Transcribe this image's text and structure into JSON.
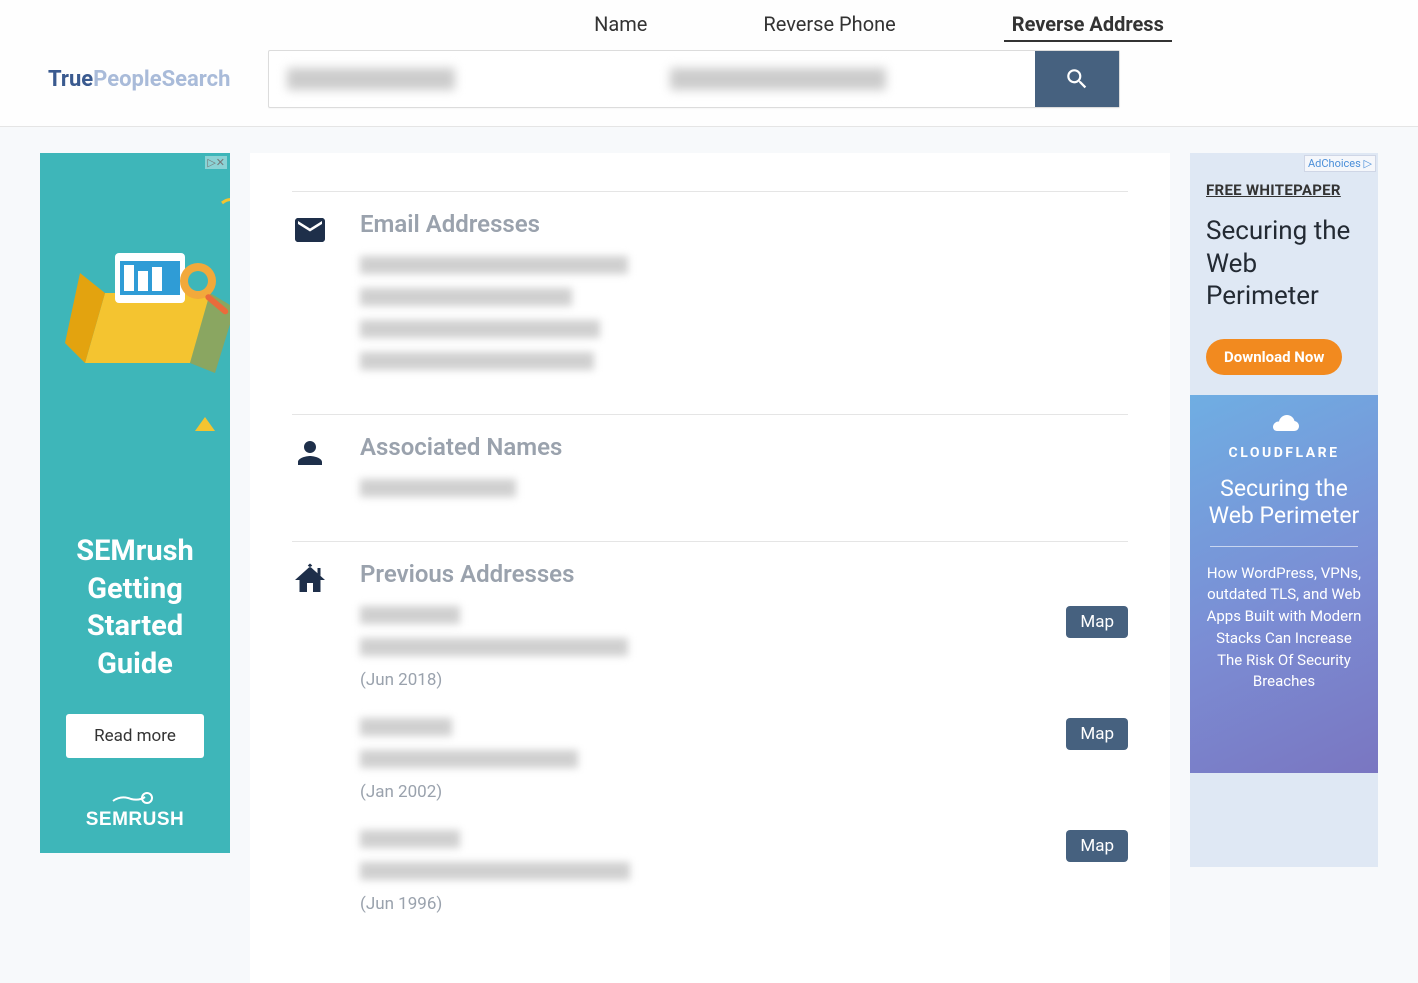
{
  "logo": {
    "part1": "True",
    "part2": "PeopleSearch"
  },
  "nav": {
    "tabs": [
      "Name",
      "Reverse Phone",
      "Reverse Address"
    ],
    "activeIndex": 2
  },
  "search": {
    "left_redacted_width": 168,
    "right_redacted_width": 216
  },
  "ad_left": {
    "badge": "▷✕",
    "title": "SEMrush Getting Started Guide",
    "button": "Read more",
    "brand": "SEMRUSH"
  },
  "sections": {
    "emails": {
      "title": "Email Addresses",
      "lines": [
        268,
        212,
        240,
        234
      ]
    },
    "names": {
      "title": "Associated Names",
      "lines": [
        156
      ]
    },
    "addresses": {
      "title": "Previous Addresses",
      "items": [
        {
          "line1_w": 100,
          "line2_w": 268,
          "date": "(Jun 2018)",
          "map": "Map"
        },
        {
          "line1_w": 92,
          "line2_w": 218,
          "date": "(Jan 2002)",
          "map": "Map"
        },
        {
          "line1_w": 100,
          "line2_w": 270,
          "date": "(Jun 1996)",
          "map": "Map"
        }
      ]
    }
  },
  "ad_right": {
    "adchoices": "AdChoices ▷",
    "whitepaper_label": "FREE WHITEPAPER",
    "title": "Securing the Web Perimeter",
    "button": "Download Now",
    "brand": "CLOUDFLARE",
    "bottom_title": "Securing the Web Perimeter",
    "desc": "How WordPress, VPNs, outdated TLS, and Web Apps Built with Modern Stacks Can Increase The Risk Of Security Breaches"
  }
}
